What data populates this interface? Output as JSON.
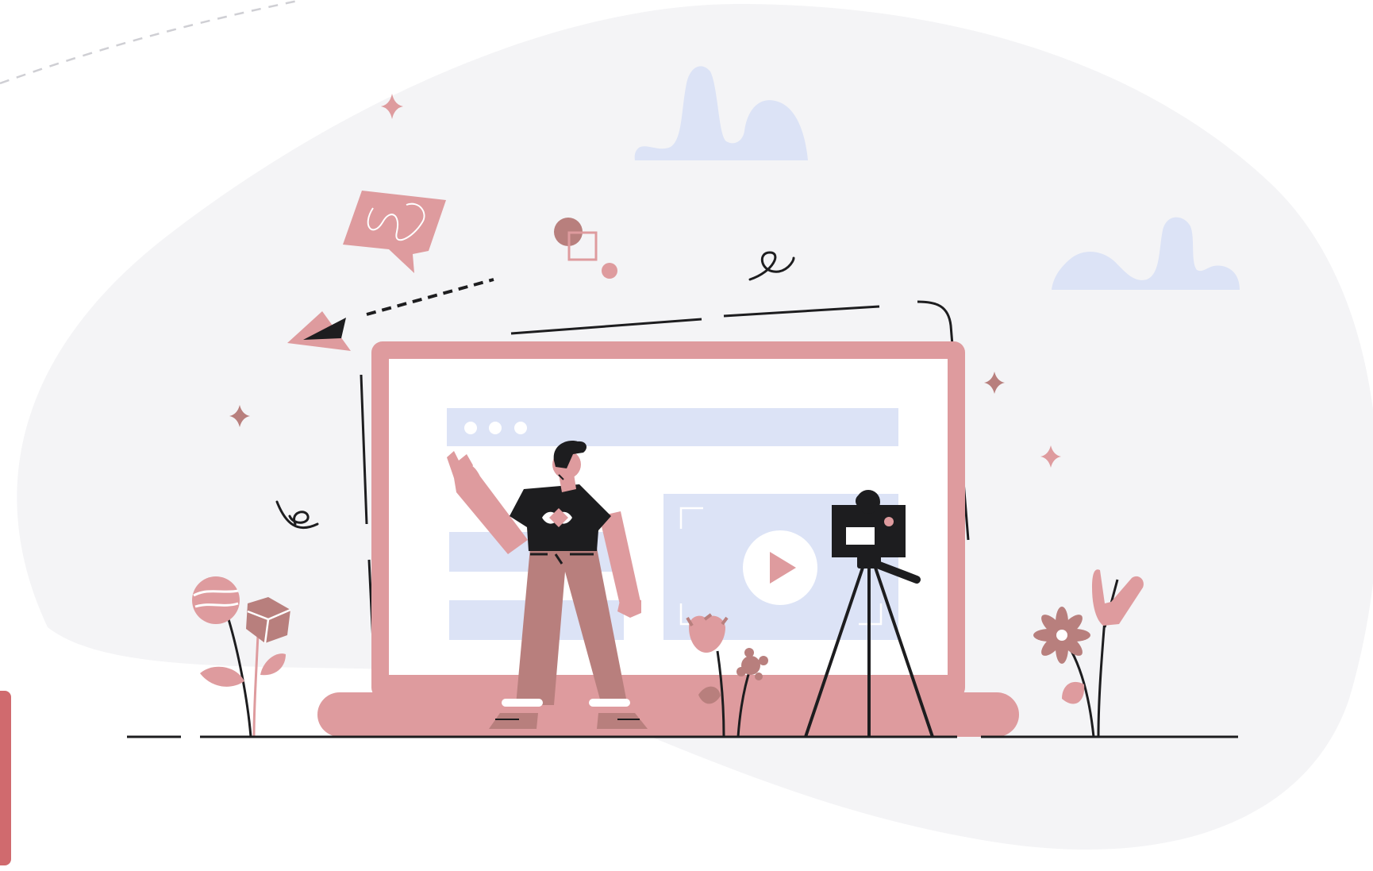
{
  "colors": {
    "background": "#ffffff",
    "blob": "#f4f4f6",
    "accent_pink": "#de9b9e",
    "deep_rose": "#b87f7d",
    "lavender": "#dce3f6",
    "ink": "#1d1d1f",
    "edge_tab": "#d06a6e"
  },
  "icons": {
    "play": "play-icon",
    "camera": "camera-icon",
    "paper_plane": "paper-plane-icon",
    "speech_bubble": "speech-bubble-icon",
    "sparkle": "sparkle-icon"
  }
}
